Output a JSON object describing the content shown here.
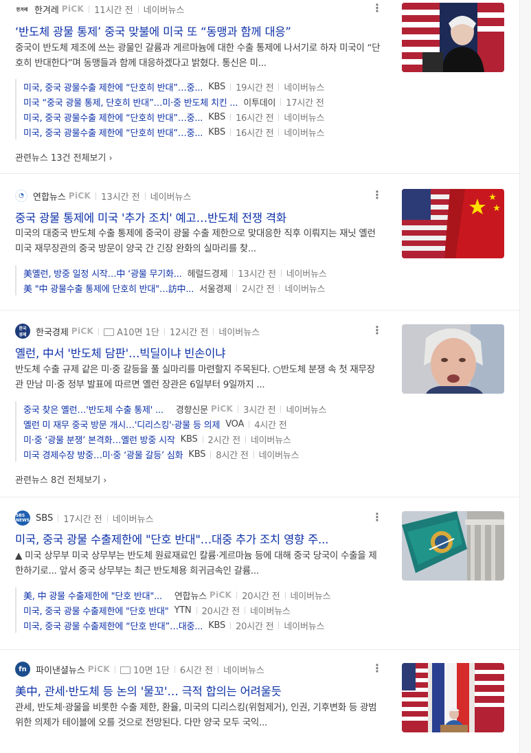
{
  "articles": [
    {
      "press": "한겨레",
      "pick": "PiCK",
      "time": "11시간 전",
      "source": "네이버뉴스",
      "title": "‘반도체 광물 통제’ 중국 맞불에 미국 또 “동맹과 함께 대응”",
      "desc": "중국이 반도체 제조에 쓰는 광물인 갈륨과 게르마늄에 대한 수출 통제에 나서기로 하자 미국이 “단호히 반대한다”며 동맹들과 함께 대응하겠다고 밝혔다. 통신은 미...",
      "related": [
        {
          "title": "미국, 중국 광물수출 제한에 “단호히 반대”…중...",
          "press": "KBS",
          "time": "19시간 전",
          "source": "네이버뉴스"
        },
        {
          "title": "미국 “중국 광물 통제, 단호히 반대”…미·중 반도체 치킨 ...",
          "press": "이투데이",
          "time": "17시간 전",
          "source": ""
        },
        {
          "title": "미국, 중국 광물수출 제한에 “단호히 반대”…중...",
          "press": "KBS",
          "time": "16시간 전",
          "source": "네이버뉴스"
        },
        {
          "title": "미국, 중국 광물수출 제한에 “단호히 반대”…중...",
          "press": "KBS",
          "time": "16시간 전",
          "source": "네이버뉴스"
        }
      ],
      "more": "관련뉴스 13건 전체보기"
    },
    {
      "press": "연합뉴스",
      "pick": "PiCK",
      "time": "13시간 전",
      "source": "네이버뉴스",
      "title": "중국 광물 통제에 미국 '추가 조치' 예고…반도체 전쟁 격화",
      "desc": "미국의 대중국 반도체 수출 통제에 중국이 광물 수출 제한으로 맞대응한 직후 이뤄지는 재닛 옐런 미국 재무장관의 중국 방문이 양국 간 긴장 완화의 실마리를 찾...",
      "related": [
        {
          "title": "美옐런, 방중 일정 시작…中 ‘광물 무기화...",
          "press": "헤럴드경제",
          "time": "13시간 전",
          "source": "네이버뉴스"
        },
        {
          "title": "美 \"中 광물수출 통제에 단호히 반대\"…訪中...",
          "press": "서울경제",
          "time": "2시간 전",
          "source": "네이버뉴스"
        }
      ]
    },
    {
      "press": "한국경제",
      "pick": "PiCK",
      "paper": "A10면 1단",
      "time": "12시간 전",
      "source": "네이버뉴스",
      "title": "옐런, 中서 '반도체 담판'…빅딜이냐 빈손이냐",
      "desc": "반도체 수출 규제 같은 미·중 갈등을 풀 실마리를 마련할지 주목된다. ○반도체 분쟁 속 첫 재무장관 만남 미·중 정부 발표에 따르면 옐런 장관은 6일부터 9일까지 ...",
      "related": [
        {
          "title": "중국 찾은 옐런…'반도체 수출 통제' ...",
          "press": "경향신문",
          "pick": "PiCK",
          "time": "3시간 전",
          "source": "네이버뉴스"
        },
        {
          "title": "옐런 미 재무 중국 방문 개시…'디리스킹'·광물 등 의제",
          "press": "VOA",
          "time": "4시간 전",
          "source": ""
        },
        {
          "title": "미·중 ‘광물 분쟁’ 본격화…옐런 방중 시작",
          "press": "KBS",
          "time": "2시간 전",
          "source": "네이버뉴스"
        },
        {
          "title": "미국 경제수장 방중…미·중 ‘광물 갈등’ 심화",
          "press": "KBS",
          "time": "8시간 전",
          "source": "네이버뉴스"
        }
      ],
      "more": "관련뉴스 8건 전체보기"
    },
    {
      "press": "SBS",
      "time": "17시간 전",
      "source": "네이버뉴스",
      "title": "미국, 중국 광물 수출제한에 \"단호 반대\"…대중 추가 조치 영향 주...",
      "desc": "▲ 미국 상무부 미국 상무부는 반도체 원료재료인 칼륨·게르마늄 등에 대해 중국 당국이 수출을 제한하기로... 앞서 중국 상무부는 최근 반도체용 희귀금속인 갈륨...",
      "related": [
        {
          "title": "美, 中 광물 수출제한에 \"단호 반대\"...",
          "press": "연합뉴스",
          "pick": "PiCK",
          "time": "20시간 전",
          "source": "네이버뉴스"
        },
        {
          "title": "미국, 중국 광물 수출제한에 \"단호 반대\"",
          "press": "YTN",
          "time": "20시간 전",
          "source": "네이버뉴스"
        },
        {
          "title": "미국, 중국 광물 수출제한에 “단호 반대”…대중...",
          "press": "KBS",
          "time": "20시간 전",
          "source": "네이버뉴스"
        }
      ]
    },
    {
      "press": "파이낸셜뉴스",
      "pick": "PiCK",
      "paper": "10면 1단",
      "time": "6시간 전",
      "source": "네이버뉴스",
      "title": "美中, 관세·반도체 등 논의 '물꼬'… 극적 합의는 어려울듯",
      "desc": "관세, 반도체·광물을 비롯한 수출 제한, 환율, 미국의 디리스킹(위험제거), 인권, 기후변화 등 광범위한 의제가 테이블에 오를 것으로 전망된다. 다만 양국 모두 국익..."
    }
  ],
  "colors": {
    "title": "#0d31a8",
    "text": "#404040",
    "meta": "#777777",
    "pick": "#b0b0b0"
  },
  "icons": [
    "more-options-icon",
    "paper-icon",
    "chevron-right-icon"
  ]
}
